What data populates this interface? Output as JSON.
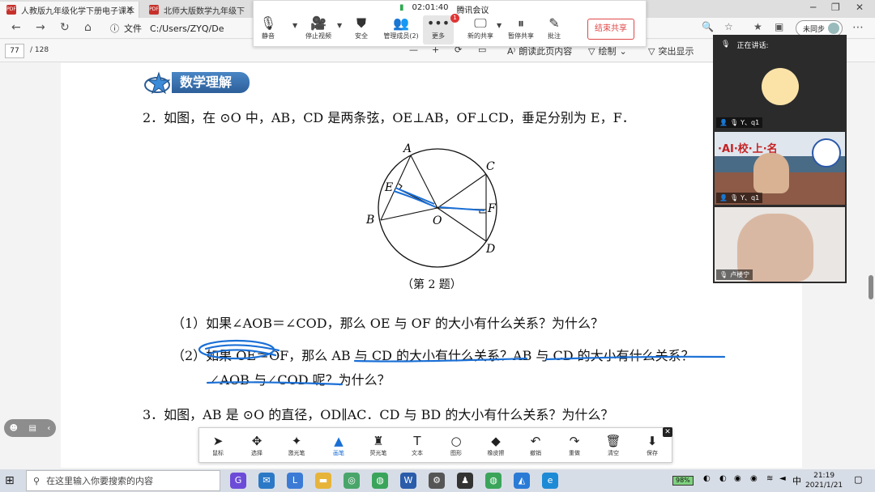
{
  "browser": {
    "tabs": [
      {
        "title": "人教版九年级化学下册电子课本"
      },
      {
        "title": "北师大版数学九年级下"
      }
    ],
    "file_label": "文件",
    "url": "C:/Users/ZYQ/De",
    "sync_label": "未同步"
  },
  "pdf_toolbar": {
    "page_current": "77",
    "page_total": "/ 128",
    "read_aloud": "朗读此页内容",
    "draw": "绘制",
    "highlight": "突出显示"
  },
  "meeting": {
    "timer": "02:01:40",
    "app_name": "腾讯会议",
    "buttons": [
      {
        "label": "静音",
        "icon": "microphone-icon"
      },
      {
        "label": "停止视频",
        "icon": "video-camera-icon"
      },
      {
        "label": "安全",
        "icon": "shield-icon"
      },
      {
        "label": "管理成员(2)",
        "icon": "members-icon"
      },
      {
        "label": "更多",
        "icon": "more-icon",
        "badge": "1"
      },
      {
        "label": "新的共享",
        "icon": "share-screen-icon"
      },
      {
        "label": "暂停共享",
        "icon": "pause-share-icon"
      },
      {
        "label": "批注",
        "icon": "annotate-icon"
      }
    ],
    "end_share": "结束共享"
  },
  "speakers": {
    "heading": "正在讲话:",
    "videos": [
      {
        "label": "Y、q1"
      },
      {
        "label": "Y、q1",
        "banner": "·AI·校·上·名"
      },
      {
        "label": "卢楼宁"
      }
    ]
  },
  "document": {
    "section_title": "数学理解",
    "q2": "2．如图，在 ⊙O 中，AB，CD 是两条弦，OE⊥AB，OF⊥CD，垂足分别为 E，F．",
    "figure_caption": "（第 2 题）",
    "figure_points": {
      "A": "A",
      "B": "B",
      "C": "C",
      "D": "D",
      "E": "E",
      "F": "F",
      "O": "O"
    },
    "q2_1": "（1）如果∠AOB＝∠COD，那么 OE 与 OF 的大小有什么关系？为什么？",
    "q2_2a": "（2）如果 OE＝OF，那么 AB 与 CD 的大小有什么关系？AB 与 CD 的大小有什么关系？",
    "q2_2b": "∠AOB 与∠COD 呢？为什么？",
    "q3": "3．如图，AB 是 ⊙O 的直径，OD∥AC．CD 与 BD 的大小有什么关系？为什么？"
  },
  "annotation_toolbar": {
    "tools": [
      {
        "label": "鼠标",
        "icon": "cursor-icon"
      },
      {
        "label": "选择",
        "icon": "move-icon"
      },
      {
        "label": "激光笔",
        "icon": "laser-pointer-icon"
      },
      {
        "label": "画笔",
        "icon": "pen-icon"
      },
      {
        "label": "荧光笔",
        "icon": "highlighter-icon"
      },
      {
        "label": "文本",
        "icon": "text-icon"
      },
      {
        "label": "图形",
        "icon": "shape-icon"
      },
      {
        "label": "橡皮擦",
        "icon": "eraser-icon"
      },
      {
        "label": "撤销",
        "icon": "undo-icon"
      },
      {
        "label": "重做",
        "icon": "redo-icon"
      },
      {
        "label": "清空",
        "icon": "trash-icon"
      },
      {
        "label": "保存",
        "icon": "save-icon"
      }
    ],
    "active_color": "#1a6fd6"
  },
  "taskbar": {
    "search_placeholder": "在这里输入你要搜索的内容",
    "battery": "98%",
    "ime": "中",
    "time": "21:19",
    "date": "2021/1/21"
  }
}
